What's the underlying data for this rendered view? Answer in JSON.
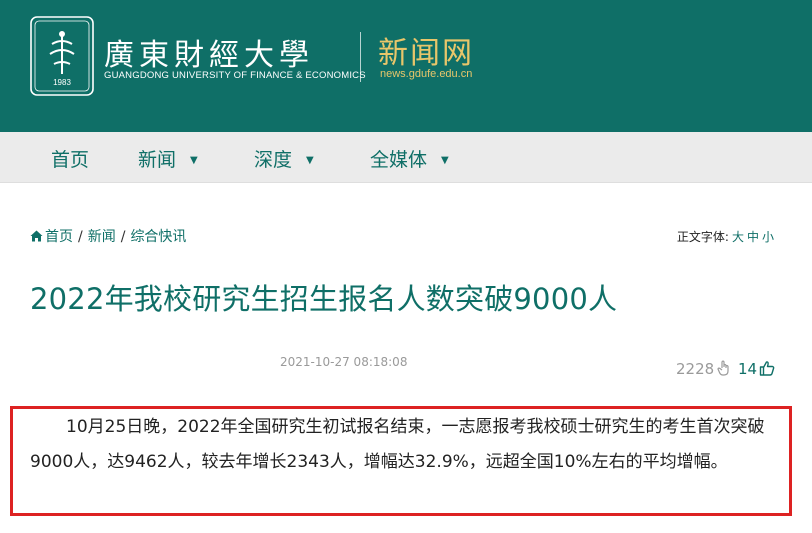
{
  "header": {
    "university_name_cn": "廣東財經大學",
    "university_name_en": "GUANGDONG UNIVERSITY OF FINANCE & ECONOMICS",
    "seal_year": "1983",
    "site_name": "新闻网",
    "site_url": "news.gdufe.edu.cn",
    "bg_color": "#0f6f67",
    "accent_color": "#e8c66a"
  },
  "nav": {
    "items": [
      {
        "label": "首页",
        "has_dropdown": false
      },
      {
        "label": "新闻",
        "has_dropdown": true
      },
      {
        "label": "深度",
        "has_dropdown": true
      },
      {
        "label": "全媒体",
        "has_dropdown": true
      }
    ],
    "caret": "▼"
  },
  "breadcrumb": {
    "home": "首页",
    "level1": "新闻",
    "level2": "综合快讯",
    "separator": "/"
  },
  "font_size_control": {
    "label": "正文字体:",
    "large": "大",
    "medium": "中",
    "small": "小"
  },
  "article": {
    "title": "2022年我校研究生招生报名人数突破9000人",
    "date": "2021-10-27 08:18:08",
    "views": "2228",
    "likes": "14",
    "body": "10月25日晚，2022年全国研究生初试报名结束，一志愿报考我校硕士研究生的考生首次突破9000人，达9462人，较去年增长2343人，增幅达32.9%，远超全国10%左右的平均增幅。"
  },
  "colors": {
    "primary": "#0f6f67",
    "highlight_border": "#dd2222",
    "muted": "#9a9a9a"
  }
}
